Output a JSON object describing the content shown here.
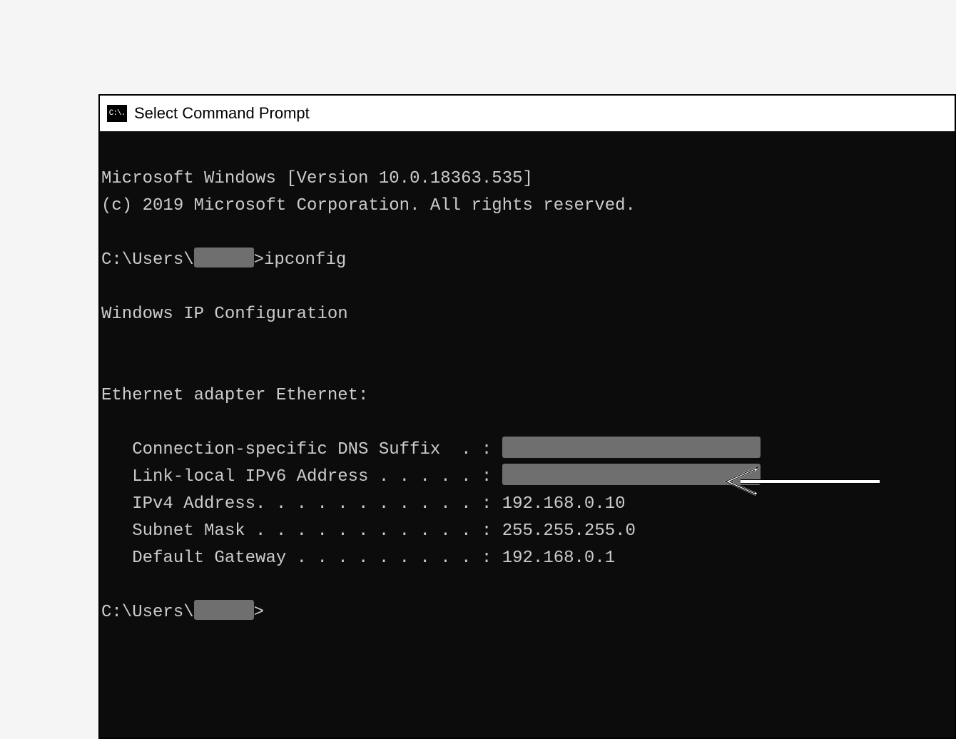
{
  "window": {
    "icon_label": "C:\\.",
    "title": "Select Command Prompt"
  },
  "terminal": {
    "version_line": "Microsoft Windows [Version 10.0.18363.535]",
    "copyright_line": "(c) 2019 Microsoft Corporation. All rights reserved.",
    "prompt_prefix": "C:\\Users\\",
    "prompt_suffix_cmd": ">ipconfig",
    "prompt_suffix_empty": ">",
    "ipconfig_header": "Windows IP Configuration",
    "adapter_header": "Ethernet adapter Ethernet:",
    "dns_suffix_label": "   Connection-specific DNS Suffix  . : ",
    "link_local_label": "   Link-local IPv6 Address . . . . . : ",
    "ipv4_label": "   IPv4 Address. . . . . . . . . . . : ",
    "ipv4_value": "192.168.0.10",
    "subnet_label": "   Subnet Mask . . . . . . . . . . . : ",
    "subnet_value": "255.255.255.0",
    "gateway_label": "   Default Gateway . . . . . . . . . : ",
    "gateway_value": "192.168.0.1"
  }
}
